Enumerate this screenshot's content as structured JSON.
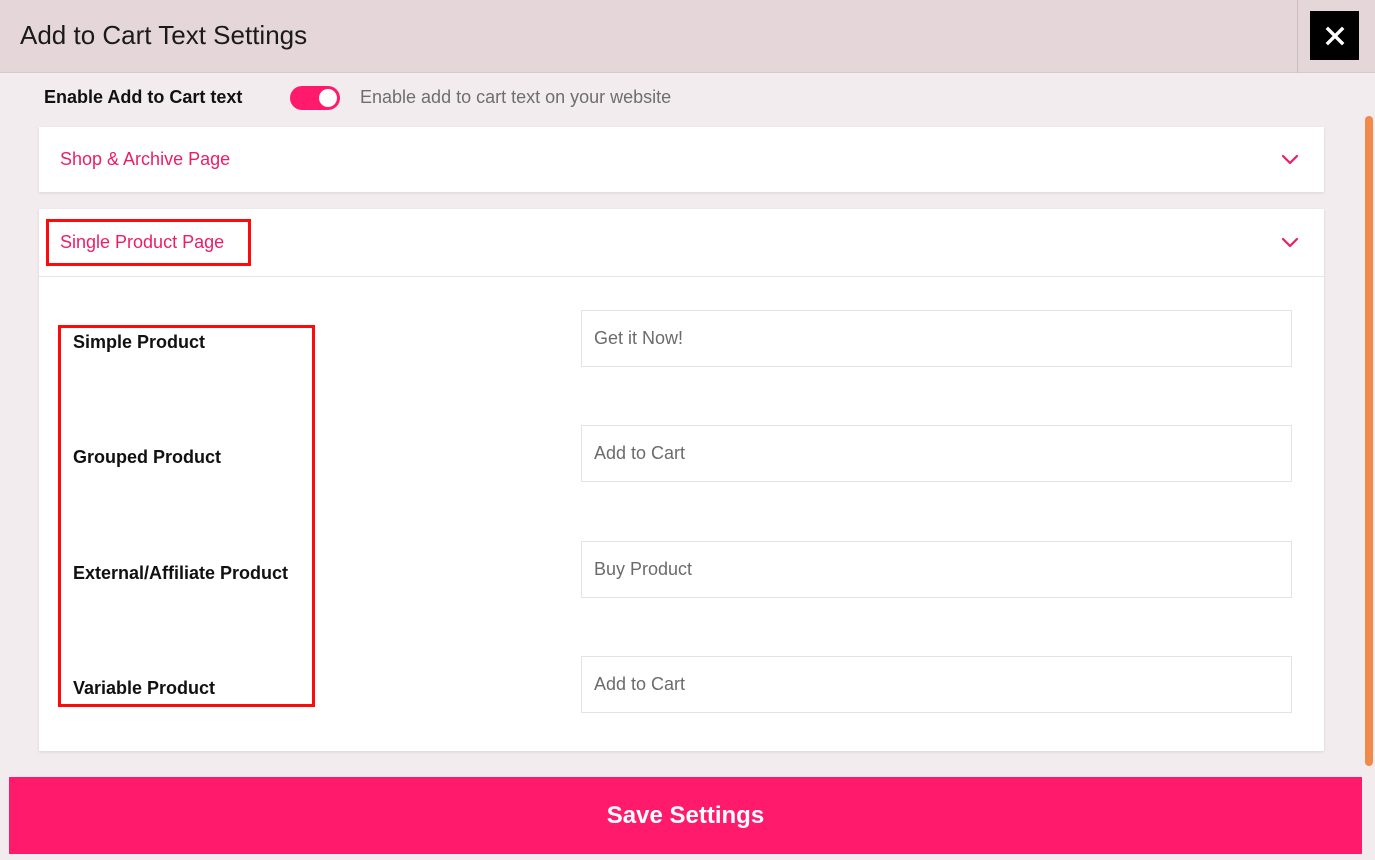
{
  "header": {
    "title": "Add to Cart Text Settings",
    "close_icon": "close-icon"
  },
  "enable": {
    "label": "Enable Add to Cart text",
    "enabled": true,
    "description": "Enable add to cart text on your website"
  },
  "sections": {
    "shop": {
      "title": "Shop & Archive Page",
      "expanded": false
    },
    "single": {
      "title": "Single Product Page",
      "expanded": true
    }
  },
  "single_product_rows": [
    {
      "label": "Simple Product",
      "value": "",
      "placeholder": "Get it Now!"
    },
    {
      "label": "Grouped Product",
      "value": "",
      "placeholder": "Add to Cart"
    },
    {
      "label": "External/Affiliate Product",
      "value": "",
      "placeholder": "Buy Product"
    },
    {
      "label": "Variable Product",
      "value": "",
      "placeholder": "Add to Cart"
    }
  ],
  "footer": {
    "save_label": "Save Settings"
  },
  "colors": {
    "accent": "#ff1a6c",
    "section_title": "#ee1c67",
    "highlight": "#ff0a0a",
    "scrollbar": "#f08a4b"
  }
}
